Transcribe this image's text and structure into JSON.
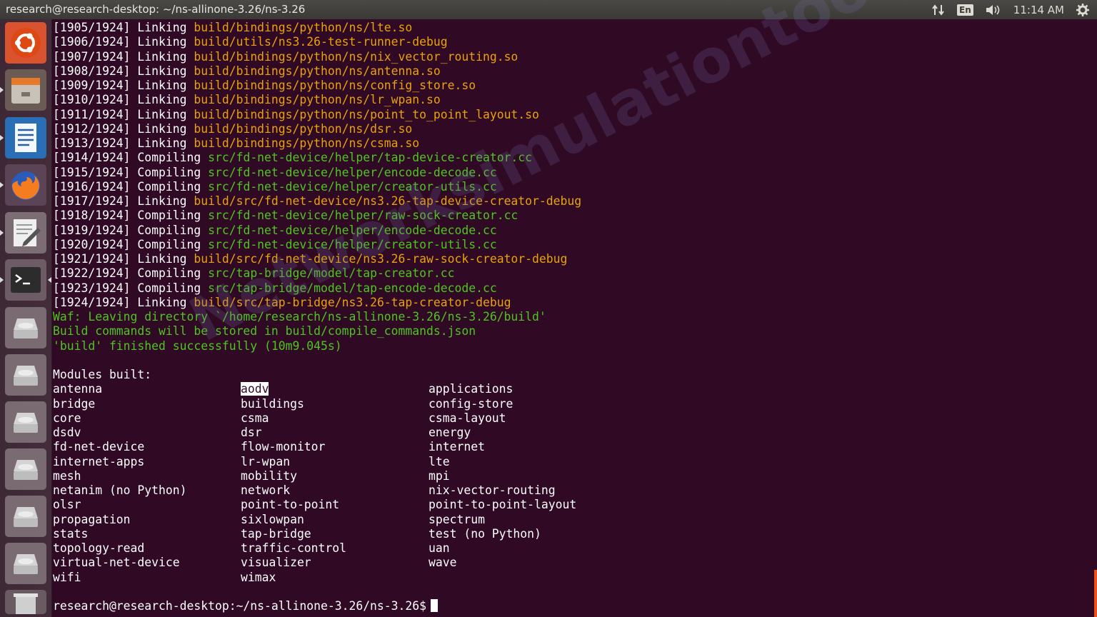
{
  "window": {
    "title": "research@research-desktop: ~/ns-allinone-3.26/ns-3.26"
  },
  "tray": {
    "lang": "En",
    "time": "11:14 AM"
  },
  "launcher": {
    "items": [
      {
        "name": "ubuntu-dash-icon"
      },
      {
        "name": "files-icon"
      },
      {
        "name": "writer-icon"
      },
      {
        "name": "firefox-icon"
      },
      {
        "name": "text-editor-icon"
      },
      {
        "name": "terminal-icon"
      },
      {
        "name": "drive-icon"
      },
      {
        "name": "drive-icon"
      },
      {
        "name": "drive-icon"
      },
      {
        "name": "drive-icon"
      },
      {
        "name": "drive-icon"
      },
      {
        "name": "drive-icon"
      },
      {
        "name": "trash-icon"
      }
    ]
  },
  "terminal": {
    "build_lines": [
      {
        "prefix": "[1905/1924] Linking ",
        "path": "build/bindings/python/ns/lte.so",
        "kind": "build"
      },
      {
        "prefix": "[1906/1924] Linking ",
        "path": "build/utils/ns3.26-test-runner-debug",
        "kind": "build"
      },
      {
        "prefix": "[1907/1924] Linking ",
        "path": "build/bindings/python/ns/nix_vector_routing.so",
        "kind": "build"
      },
      {
        "prefix": "[1908/1924] Linking ",
        "path": "build/bindings/python/ns/antenna.so",
        "kind": "build"
      },
      {
        "prefix": "[1909/1924] Linking ",
        "path": "build/bindings/python/ns/config_store.so",
        "kind": "build"
      },
      {
        "prefix": "[1910/1924] Linking ",
        "path": "build/bindings/python/ns/lr_wpan.so",
        "kind": "build"
      },
      {
        "prefix": "[1911/1924] Linking ",
        "path": "build/bindings/python/ns/point_to_point_layout.so",
        "kind": "build"
      },
      {
        "prefix": "[1912/1924] Linking ",
        "path": "build/bindings/python/ns/dsr.so",
        "kind": "build"
      },
      {
        "prefix": "[1913/1924] Linking ",
        "path": "build/bindings/python/ns/csma.so",
        "kind": "build"
      },
      {
        "prefix": "[1914/1924] Compiling ",
        "path": "src/fd-net-device/helper/tap-device-creator.cc",
        "kind": "src"
      },
      {
        "prefix": "[1915/1924] Compiling ",
        "path": "src/fd-net-device/helper/encode-decode.cc",
        "kind": "src"
      },
      {
        "prefix": "[1916/1924] Compiling ",
        "path": "src/fd-net-device/helper/creator-utils.cc",
        "kind": "src"
      },
      {
        "prefix": "[1917/1924] Linking ",
        "path": "build/src/fd-net-device/ns3.26-tap-device-creator-debug",
        "kind": "build"
      },
      {
        "prefix": "[1918/1924] Compiling ",
        "path": "src/fd-net-device/helper/raw-sock-creator.cc",
        "kind": "src"
      },
      {
        "prefix": "[1919/1924] Compiling ",
        "path": "src/fd-net-device/helper/encode-decode.cc",
        "kind": "src"
      },
      {
        "prefix": "[1920/1924] Compiling ",
        "path": "src/fd-net-device/helper/creator-utils.cc",
        "kind": "src"
      },
      {
        "prefix": "[1921/1924] Linking ",
        "path": "build/src/fd-net-device/ns3.26-raw-sock-creator-debug",
        "kind": "build"
      },
      {
        "prefix": "[1922/1924] Compiling ",
        "path": "src/tap-bridge/model/tap-creator.cc",
        "kind": "src"
      },
      {
        "prefix": "[1923/1924] Compiling ",
        "path": "src/tap-bridge/model/tap-encode-decode.cc",
        "kind": "src"
      },
      {
        "prefix": "[1924/1924] Linking ",
        "path": "build/src/tap-bridge/ns3.26-tap-creator-debug",
        "kind": "build"
      }
    ],
    "status_lines": [
      "Waf: Leaving directory `/home/research/ns-allinone-3.26/ns-3.26/build'",
      "Build commands will be stored in build/compile_commands.json",
      "'build' finished successfully (10m9.045s)"
    ],
    "modules_header": "Modules built:",
    "modules": [
      [
        "antenna",
        "aodv",
        "applications"
      ],
      [
        "bridge",
        "buildings",
        "config-store"
      ],
      [
        "core",
        "csma",
        "csma-layout"
      ],
      [
        "dsdv",
        "dsr",
        "energy"
      ],
      [
        "fd-net-device",
        "flow-monitor",
        "internet"
      ],
      [
        "internet-apps",
        "lr-wpan",
        "lte"
      ],
      [
        "mesh",
        "mobility",
        "mpi"
      ],
      [
        "netanim (no Python)",
        "network",
        "nix-vector-routing"
      ],
      [
        "olsr",
        "point-to-point",
        "point-to-point-layout"
      ],
      [
        "propagation",
        "sixlowpan",
        "spectrum"
      ],
      [
        "stats",
        "tap-bridge",
        "test (no Python)"
      ],
      [
        "topology-read",
        "traffic-control",
        "uan"
      ],
      [
        "virtual-net-device",
        "visualizer",
        "wave"
      ],
      [
        "wifi",
        "wimax",
        ""
      ]
    ],
    "highlighted_module": "aodv",
    "prompt": "research@research-desktop:~/ns-allinone-3.26/ns-3.26$"
  },
  "watermark": "Networksimulationtools.com",
  "colors": {
    "background": "#300a24",
    "build_path": "#e8a20c",
    "src_path": "#4ec520",
    "panel": "#3c3b37"
  }
}
